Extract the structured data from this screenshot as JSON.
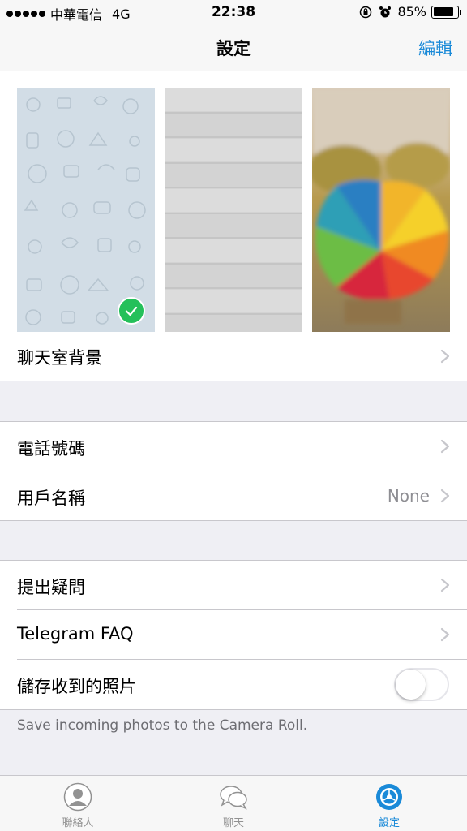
{
  "status_bar": {
    "carrier": "中華電信",
    "network": "4G",
    "time": "22:38",
    "battery_percent": "85%",
    "battery_level": 0.85
  },
  "nav": {
    "title": "設定",
    "edit_label": "編輯"
  },
  "wallpapers": {
    "items": [
      {
        "name": "pattern",
        "selected": true
      },
      {
        "name": "gray-wood",
        "selected": false
      },
      {
        "name": "umbrella",
        "selected": false
      }
    ],
    "row_label": "聊天室背景"
  },
  "account": {
    "phone_label": "電話號碼",
    "username_label": "用戶名稱",
    "username_value": "None"
  },
  "support": {
    "ask_label": "提出疑問",
    "faq_label": "Telegram FAQ",
    "save_photos_label": "儲存收到的照片",
    "save_photos_on": false,
    "footnote": "Save incoming photos to the Camera Roll."
  },
  "tabs": [
    {
      "label": "聯絡人",
      "icon": "contacts-icon",
      "active": false
    },
    {
      "label": "聊天",
      "icon": "chat-icon",
      "active": false
    },
    {
      "label": "設定",
      "icon": "settings-icon",
      "active": true
    }
  ],
  "colors": {
    "accent": "#1a8ad8",
    "check": "#24c05a"
  }
}
